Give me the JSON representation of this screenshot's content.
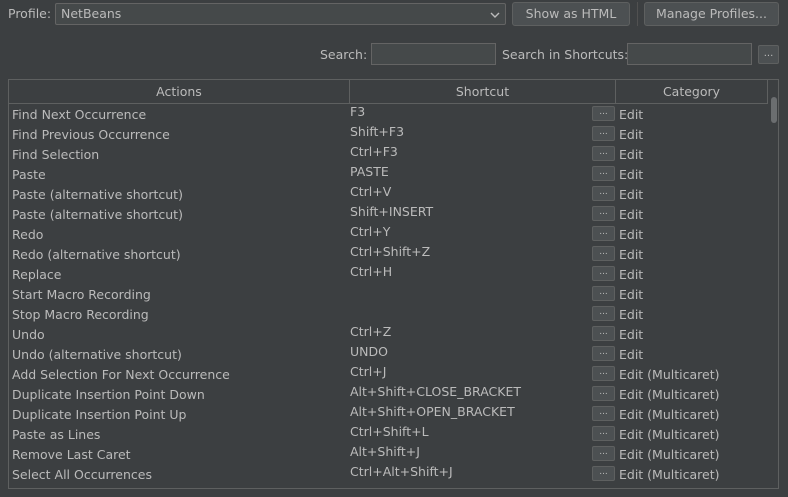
{
  "profile": {
    "label": "Profile:",
    "value": "NetBeans",
    "show_html_label": "Show as HTML",
    "manage_profiles_label": "Manage Profiles..."
  },
  "search": {
    "label": "Search:",
    "value": "",
    "shortcuts_label": "Search in Shortcuts:",
    "shortcuts_value": "",
    "shortcut_picker_label": "..."
  },
  "table": {
    "columns": [
      "Actions",
      "Shortcut",
      "Category"
    ],
    "dots_label": "...",
    "rows": [
      {
        "action": "Find Next Occurrence",
        "shortcut": "F3",
        "category": "Edit"
      },
      {
        "action": "Find Previous Occurrence",
        "shortcut": "Shift+F3",
        "category": "Edit"
      },
      {
        "action": "Find Selection",
        "shortcut": "Ctrl+F3",
        "category": "Edit"
      },
      {
        "action": "Paste",
        "shortcut": "PASTE",
        "category": "Edit"
      },
      {
        "action": "Paste (alternative shortcut)",
        "shortcut": "Ctrl+V",
        "category": "Edit"
      },
      {
        "action": "Paste (alternative shortcut)",
        "shortcut": "Shift+INSERT",
        "category": "Edit"
      },
      {
        "action": "Redo",
        "shortcut": "Ctrl+Y",
        "category": "Edit"
      },
      {
        "action": "Redo (alternative shortcut)",
        "shortcut": "Ctrl+Shift+Z",
        "category": "Edit"
      },
      {
        "action": "Replace",
        "shortcut": "Ctrl+H",
        "category": "Edit"
      },
      {
        "action": "Start Macro Recording",
        "shortcut": "",
        "category": "Edit"
      },
      {
        "action": "Stop Macro Recording",
        "shortcut": "",
        "category": "Edit"
      },
      {
        "action": "Undo",
        "shortcut": "Ctrl+Z",
        "category": "Edit"
      },
      {
        "action": "Undo (alternative shortcut)",
        "shortcut": "UNDO",
        "category": "Edit"
      },
      {
        "action": "Add Selection For Next Occurrence",
        "shortcut": "Ctrl+J",
        "category": "Edit (Multicaret)"
      },
      {
        "action": "Duplicate Insertion Point Down",
        "shortcut": "Alt+Shift+CLOSE_BRACKET",
        "category": "Edit (Multicaret)"
      },
      {
        "action": "Duplicate Insertion Point Up",
        "shortcut": "Alt+Shift+OPEN_BRACKET",
        "category": "Edit (Multicaret)"
      },
      {
        "action": "Paste as Lines",
        "shortcut": "Ctrl+Shift+L",
        "category": "Edit (Multicaret)"
      },
      {
        "action": "Remove Last Caret",
        "shortcut": "Alt+Shift+J",
        "category": "Edit (Multicaret)"
      },
      {
        "action": "Select All Occurrences",
        "shortcut": "Ctrl+Alt+Shift+J",
        "category": "Edit (Multicaret)"
      }
    ]
  },
  "icons": {
    "dropdown": "chevron-down-icon"
  },
  "colors": {
    "background": "#3c3f41",
    "field": "#45494a",
    "border": "#5e6060",
    "text": "#bbbbbb"
  }
}
